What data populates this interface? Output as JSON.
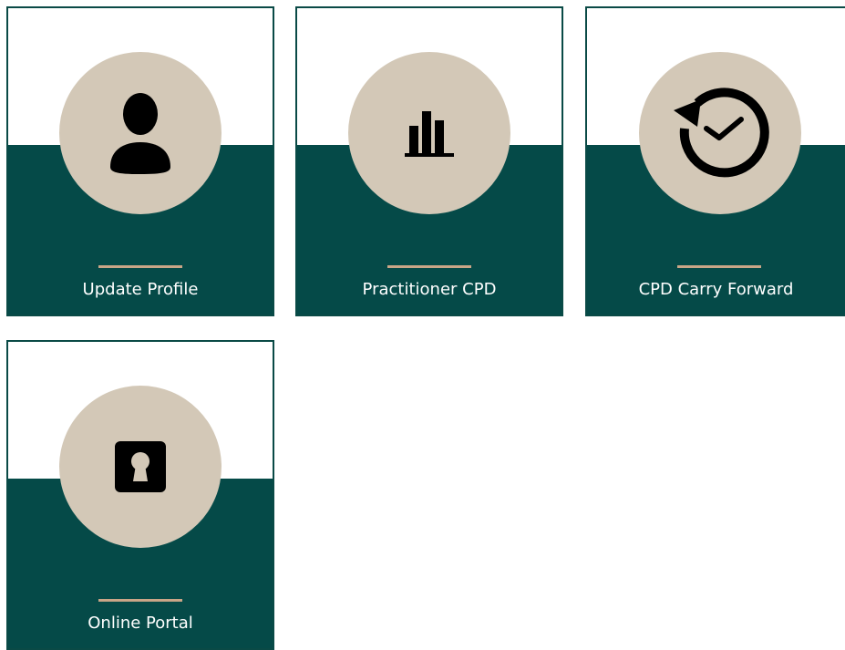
{
  "tiles": [
    {
      "label": "Update Profile",
      "icon": "user-icon"
    },
    {
      "label": "Practitioner CPD",
      "icon": "bar-chart-icon"
    },
    {
      "label": "CPD Carry Forward",
      "icon": "clock-history-icon"
    },
    {
      "label": "Online Portal",
      "icon": "keyhole-icon"
    }
  ],
  "colors": {
    "tile_bottom": "#054a48",
    "tile_border": "#0a4a46",
    "circle": "#d3c8b7",
    "accent_rule": "#c9a587",
    "icon": "#000000",
    "label_text": "#ffffff"
  }
}
